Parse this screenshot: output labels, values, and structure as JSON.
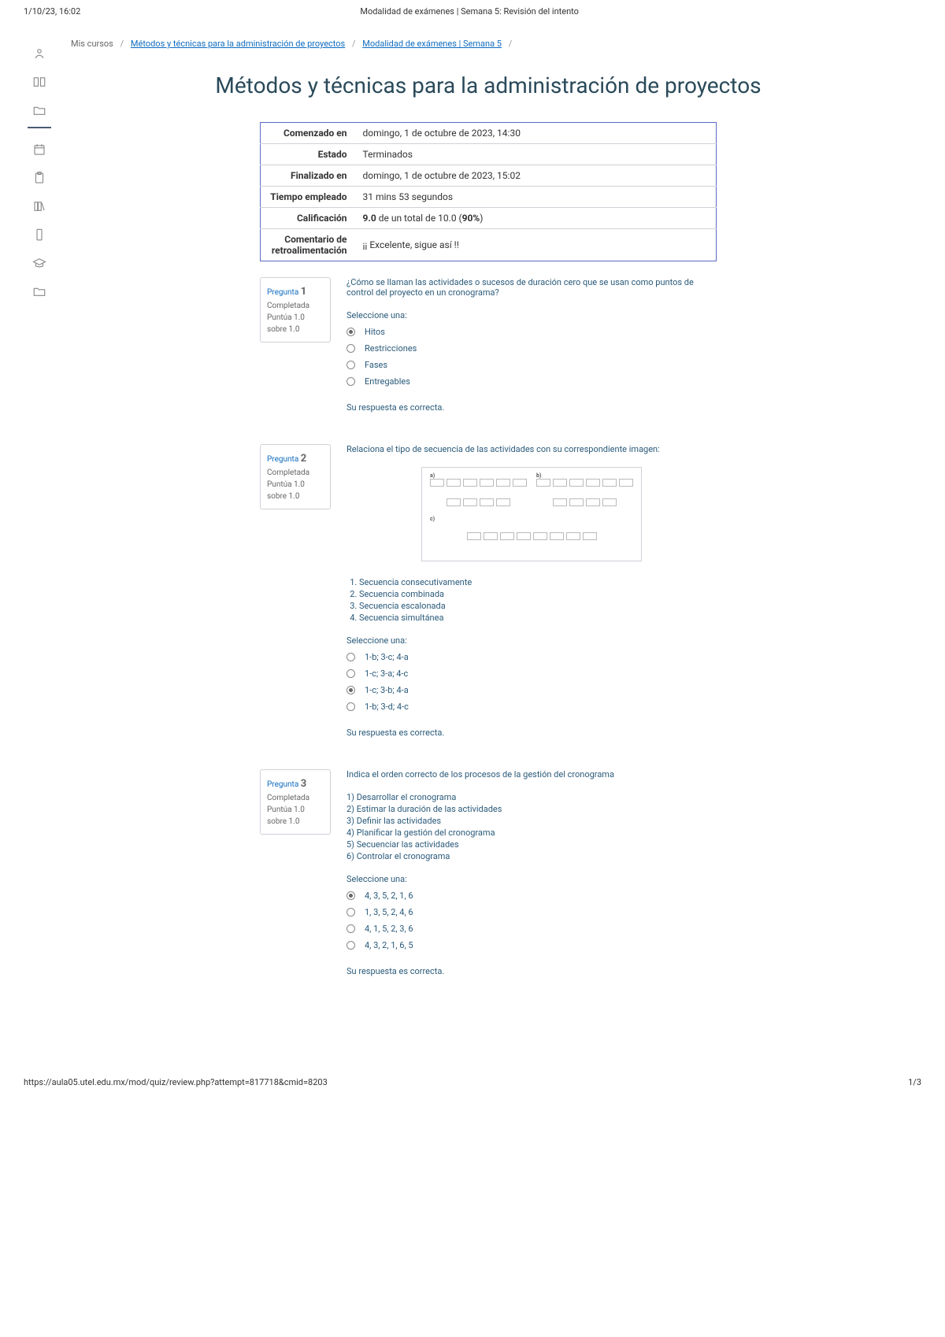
{
  "print_header": {
    "datetime": "1/10/23, 16:02",
    "title": "Modalidad de exámenes | Semana 5: Revisión del intento"
  },
  "breadcrumb": {
    "root": "Mis cursos",
    "course": "Métodos y técnicas para la administración de proyectos",
    "section": "Modalidad de exámenes | Semana 5"
  },
  "course_title": "Métodos y técnicas para la administración de proyectos",
  "summary": {
    "rows": [
      {
        "label": "Comenzado en",
        "value": "domingo, 1 de octubre de 2023, 14:30"
      },
      {
        "label": "Estado",
        "value": "Terminados"
      },
      {
        "label": "Finalizado en",
        "value": "domingo, 1 de octubre de 2023, 15:02"
      },
      {
        "label": "Tiempo empleado",
        "value": "31 mins 53 segundos"
      },
      {
        "label": "Calificación",
        "value_html": "9.0 de un total de 10.0 (90%)",
        "bold_prefix": "9.0",
        "rest": " de un total de 10.0 (",
        "bold_suffix": "90%",
        "tail": ")"
      },
      {
        "label": "Comentario de retroalimentación",
        "value": "¡¡ Excelente, sigue así !!"
      }
    ]
  },
  "question_label": "Pregunta",
  "completed_label": "Completada",
  "score_label_prefix": "Puntúa 1.0",
  "score_label_suffix": "sobre 1.0",
  "select_one": "Seleccione una:",
  "correct_feedback": "Su respuesta es correcta.",
  "questions": [
    {
      "number": "1",
      "text": "¿Cómo se llaman las actividades o sucesos de duración cero que se usan como puntos de control del proyecto en un cronograma?",
      "options": [
        {
          "label": "Hitos",
          "selected": true
        },
        {
          "label": "Restricciones",
          "selected": false
        },
        {
          "label": "Fases",
          "selected": false
        },
        {
          "label": "Entregables",
          "selected": false
        }
      ]
    },
    {
      "number": "2",
      "text": "Relaciona el tipo de secuencia de las actividades con su correspondiente imagen:",
      "image_labels": {
        "a": "a)",
        "b": "b)",
        "c": "c)"
      },
      "list": [
        "Secuencia consecutivamente",
        "Secuencia combinada",
        "Secuencia escalonada",
        "Secuencia simultánea"
      ],
      "options": [
        {
          "label": "1-b; 3-c; 4-a",
          "selected": false
        },
        {
          "label": "1-c; 3-a; 4-c",
          "selected": false
        },
        {
          "label": "1-c; 3-b; 4-a",
          "selected": true
        },
        {
          "label": "1-b; 3-d; 4-c",
          "selected": false
        }
      ]
    },
    {
      "number": "3",
      "text": "Indica el orden correcto de los procesos de la gestión del cronograma",
      "procedures": [
        "1) Desarrollar el cronograma",
        "2) Estimar la duración de las actividades",
        "3) Definir las actividades",
        "4) Planificar la gestión del cronograma",
        "5) Secuenciar las actividades",
        "6) Controlar el cronograma"
      ],
      "options": [
        {
          "label": "4, 3, 5, 2, 1, 6",
          "selected": true
        },
        {
          "label": "1, 3, 5, 2, 4, 6",
          "selected": false
        },
        {
          "label": "4, 1, 5, 2, 3, 6",
          "selected": false
        },
        {
          "label": "4, 3, 2, 1, 6, 5",
          "selected": false
        }
      ]
    }
  ],
  "print_footer": {
    "url": "https://aula05.utel.edu.mx/mod/quiz/review.php?attempt=817718&cmid=8203",
    "page": "1/3"
  }
}
